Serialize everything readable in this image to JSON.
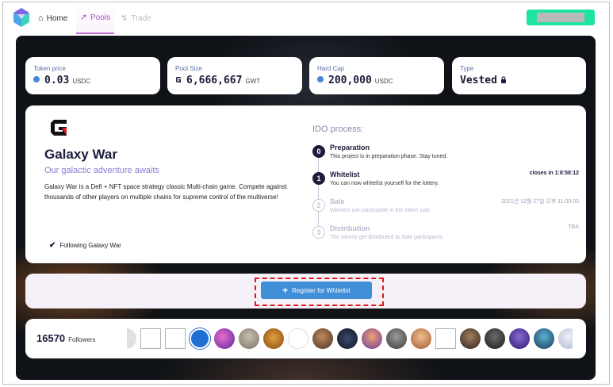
{
  "nav": {
    "home_label": "Home",
    "pools_label": "Pools",
    "trade_label": "Trade"
  },
  "stats": [
    {
      "label": "Token price",
      "value": "0.03",
      "unit": "USDC",
      "icon": "coin-icon"
    },
    {
      "label": "Pool Size",
      "value": "6,666,667",
      "unit": "GWT",
      "icon": "galaxy-war-icon"
    },
    {
      "label": "Hard Cap",
      "value": "200,000",
      "unit": "USDC",
      "icon": "coin-icon"
    },
    {
      "label": "Type",
      "value": "Vested",
      "unit": "",
      "icon": "lock-icon"
    }
  ],
  "project": {
    "title": "Galaxy War",
    "tagline": "Our galactic adventure awaits",
    "description": "Galaxy War is a Defi + NFT space strategy classic Multi-chain game. Compete against thousands of other players on multiple chains for supreme control of the multiverse!",
    "follow_label": "Following Galaxy War"
  },
  "ido": {
    "title": "IDO process:",
    "steps": [
      {
        "number": "0",
        "name": "Preparation",
        "desc": "This project is in preparation phase. Stay tuned.",
        "right": ""
      },
      {
        "number": "1",
        "name": "Whitelist",
        "desc": "You can now whitelist yourself for the lottery.",
        "right": "closes in 1:8:58:12"
      },
      {
        "number": "2",
        "name": "Sale",
        "desc": "Winners can participate in the token sale.",
        "right": "2021년 12월 27일 오후 11:00:00"
      },
      {
        "number": "3",
        "name": "Distribution",
        "desc": "The tokens get distributed to Sale participants.",
        "right": "TBA"
      }
    ]
  },
  "register": {
    "button_label": "Register for Whitelist"
  },
  "followers": {
    "count": "16570",
    "label": "Followers"
  },
  "colors": {
    "accent": "#a855c7",
    "account_button": "#1fe3a3",
    "register_button": "#3f8fd9",
    "highlight_outline": "#e01818",
    "text_dark": "#1c1c3c"
  }
}
